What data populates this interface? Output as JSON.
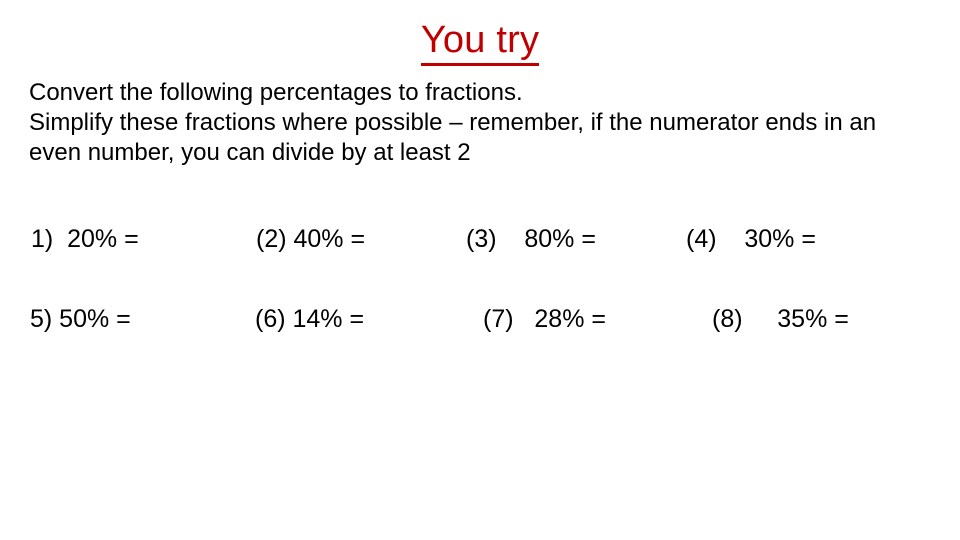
{
  "slide": {
    "title": "You try",
    "title_color": "#C00000",
    "background_color": "#FFFFFF",
    "text_color": "#000000",
    "intro_lines": [
      "Convert the following percentages to fractions.",
      "Simplify these fractions where possible – remember, if the numerator ends in an even number, you can divide by at least 2"
    ],
    "question_rows": [
      {
        "items": [
          "1)  20% =",
          "(2) 40% =",
          "(3)    80% =",
          "(4)    30% ="
        ]
      },
      {
        "items": [
          "5) 50% =",
          "(6) 14% =",
          "(7)   28% =",
          "(8)     35% ="
        ]
      }
    ]
  }
}
